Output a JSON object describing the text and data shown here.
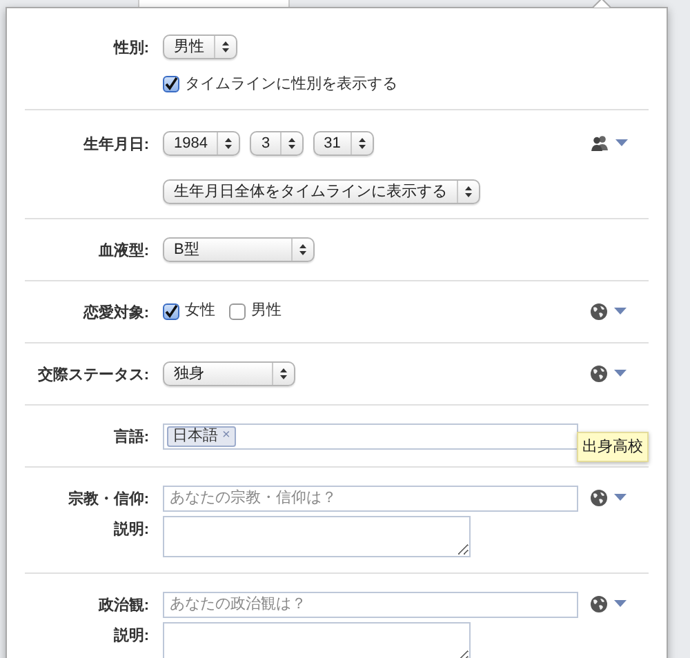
{
  "rows": [
    {
      "kind": "gender",
      "label": "性別:",
      "selects": [
        "男性"
      ],
      "checkbox": {
        "label": "タイムラインに性別を表示する",
        "checked": true
      }
    },
    {
      "kind": "birthday",
      "label": "生年月日:",
      "selects": [
        "1984",
        "3",
        "31"
      ],
      "display_select": "生年月日全体をタイムラインに表示する",
      "privacy": {
        "kind": "friends"
      }
    },
    {
      "kind": "select",
      "label": "血液型:",
      "selects": [
        "B型"
      ]
    },
    {
      "kind": "checks",
      "label": "恋愛対象:",
      "options": [
        {
          "label": "女性",
          "checked": true
        },
        {
          "label": "男性",
          "checked": false
        }
      ],
      "privacy": {
        "kind": "public"
      }
    },
    {
      "kind": "select",
      "label": "交際ステータス:",
      "selects": [
        "独身"
      ],
      "privacy": {
        "kind": "public"
      }
    },
    {
      "kind": "tokens",
      "label": "言語:",
      "tokens": [
        {
          "label": "日本語",
          "remove": "×"
        }
      ],
      "tooltip": "出身高校"
    },
    {
      "kind": "text",
      "label": "宗教・信仰:",
      "placeholder": "あなたの宗教・信仰は？",
      "privacy": {
        "kind": "public"
      },
      "note_label": "説明:"
    },
    {
      "kind": "text",
      "label": "政治観:",
      "placeholder": "あなたの政治観は？",
      "privacy": {
        "kind": "public"
      },
      "note_label": "説明:"
    }
  ]
}
